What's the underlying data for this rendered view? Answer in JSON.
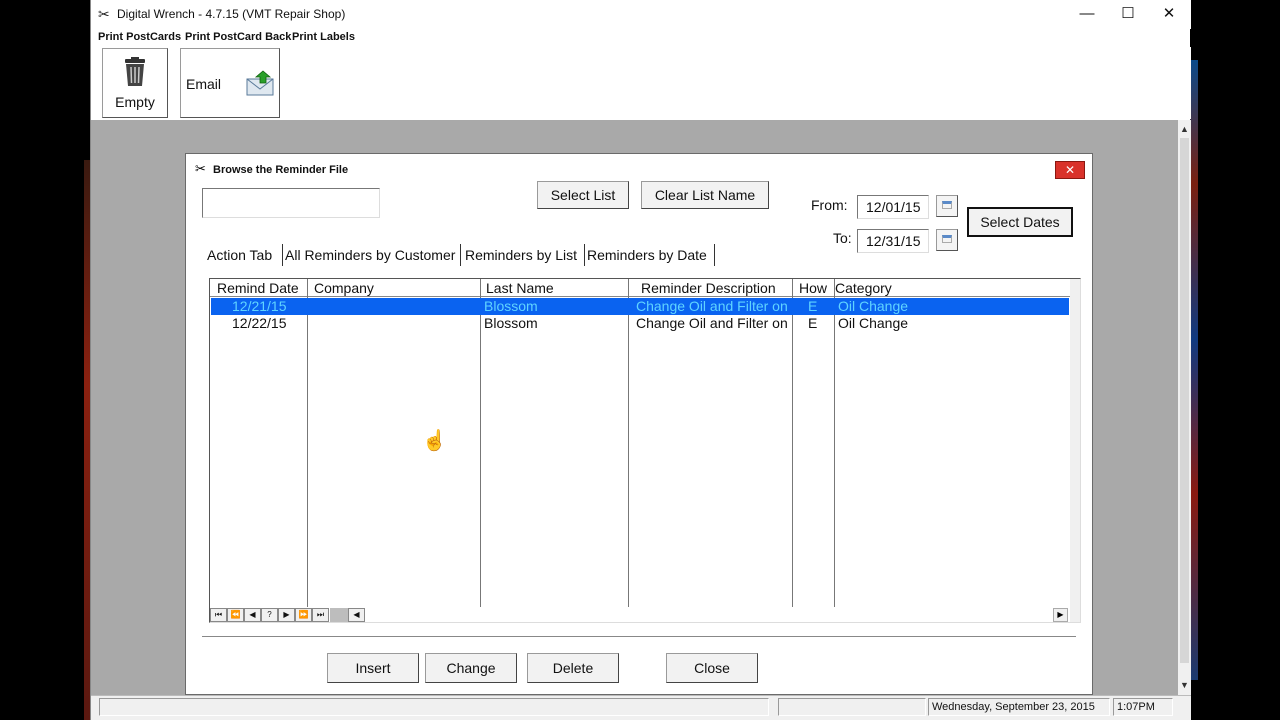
{
  "window": {
    "title": "Digital Wrench - 4.7.15 (VMT Repair Shop)",
    "minimize": "—",
    "maximize": "☐",
    "close": "✕"
  },
  "menu": [
    "Print PostCards",
    "Print PostCard Back",
    "Print Labels"
  ],
  "toolbar": {
    "empty_label": "Empty",
    "email_label": "Email"
  },
  "dialog": {
    "title": "Browse the Reminder File",
    "close": "✕",
    "list_name_value": "",
    "select_list": "Select List",
    "clear_list_name": "Clear List Name",
    "from_label": "From:",
    "from_value": "12/01/15",
    "to_label": "To:",
    "to_value": "12/31/15",
    "select_dates": "Select Dates",
    "tabs": [
      "Action Tab",
      "All Reminders by Customer",
      "Reminders by List",
      "Reminders by Date"
    ],
    "columns": [
      "Remind Date",
      "Company",
      "Last Name",
      "Reminder Description",
      "How",
      "Category"
    ],
    "rows": [
      {
        "date": "12/21/15",
        "company": "",
        "last_name": "Blossom",
        "description": "Change Oil and Filter on",
        "how": "E",
        "category": "Oil Change",
        "selected": true
      },
      {
        "date": "12/22/15",
        "company": "",
        "last_name": "Blossom",
        "description": "Change Oil and Filter on",
        "how": "E",
        "category": "Oil Change",
        "selected": false
      }
    ],
    "nav": [
      "⏮",
      "⏪",
      "◀",
      "?",
      "▶",
      "⏩",
      "⏭"
    ],
    "buttons": {
      "insert": "Insert",
      "change": "Change",
      "delete": "Delete",
      "close": "Close"
    }
  },
  "status": {
    "date": "Wednesday, September 23, 2015",
    "time": "1:07PM"
  },
  "icons": [
    "wrench-icon",
    "trash-icon",
    "email-upload-icon",
    "calendar-icon",
    "hand-cursor-icon"
  ]
}
